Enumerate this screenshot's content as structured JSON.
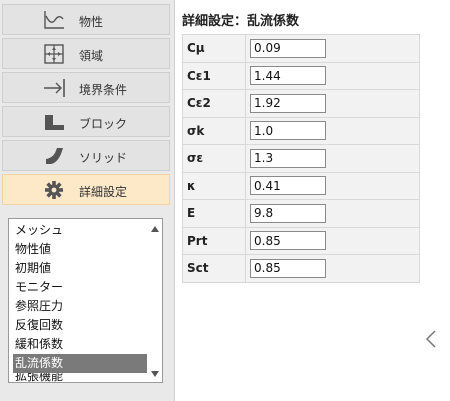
{
  "nav": {
    "items": [
      {
        "label": "物性",
        "icon": "chart-axes-icon"
      },
      {
        "label": "領域",
        "icon": "region-grid-icon"
      },
      {
        "label": "境界条件",
        "icon": "arrow-to-wall-icon"
      },
      {
        "label": "ブロック",
        "icon": "block-icon"
      },
      {
        "label": "ソリッド",
        "icon": "solid-shape-icon"
      },
      {
        "label": "詳細設定",
        "icon": "gear-icon"
      }
    ],
    "active_index": 5
  },
  "list": {
    "items": [
      "メッシュ",
      "物性値",
      "初期値",
      "モニター",
      "参照圧力",
      "反復回数",
      "緩和係数",
      "乱流係数",
      "拡張機能"
    ],
    "selected": "乱流係数"
  },
  "panel": {
    "title": "詳細設定：乱流係数",
    "params": [
      {
        "label": "Cμ",
        "value": "0.09"
      },
      {
        "label": "Cε1",
        "value": "1.44"
      },
      {
        "label": "Cε2",
        "value": "1.92"
      },
      {
        "label": "σk",
        "value": "1.0"
      },
      {
        "label": "σε",
        "value": "1.3"
      },
      {
        "label": "κ",
        "value": "0.41"
      },
      {
        "label": "E",
        "value": "9.8"
      },
      {
        "label": "Prt",
        "value": "0.85"
      },
      {
        "label": "Sct",
        "value": "0.85"
      }
    ]
  },
  "colors": {
    "active_nav": "#fde8c8",
    "selected_item": "#7a7a7a"
  }
}
